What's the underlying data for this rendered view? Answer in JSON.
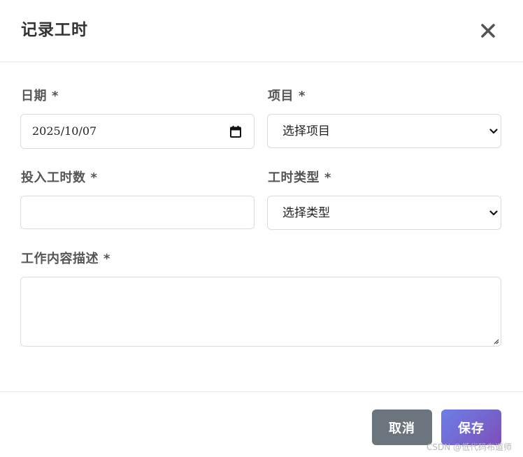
{
  "dialog": {
    "title": "记录工时"
  },
  "form": {
    "date": {
      "label": "日期",
      "required_mark": "*",
      "value": "2025/10/07"
    },
    "project": {
      "label": "项目",
      "required_mark": "*",
      "selected": "选择项目"
    },
    "hours": {
      "label": "投入工时数",
      "required_mark": "*",
      "value": ""
    },
    "work_type": {
      "label": "工时类型",
      "required_mark": "*",
      "selected": "选择类型"
    },
    "description": {
      "label": "工作内容描述",
      "required_mark": "*",
      "value": ""
    }
  },
  "footer": {
    "cancel_label": "取消",
    "save_label": "保存"
  },
  "watermark": "CSDN @低代码布道师",
  "colors": {
    "cancel_button": "#6c757d",
    "save_button_gradient_start": "#6d7fe8",
    "save_button_gradient_end": "#7d4fb8",
    "border": "#dcdcdc"
  },
  "icons": {
    "close": "close-icon",
    "calendar": "calendar-icon",
    "select_arrow": "chevron-down-icon"
  }
}
